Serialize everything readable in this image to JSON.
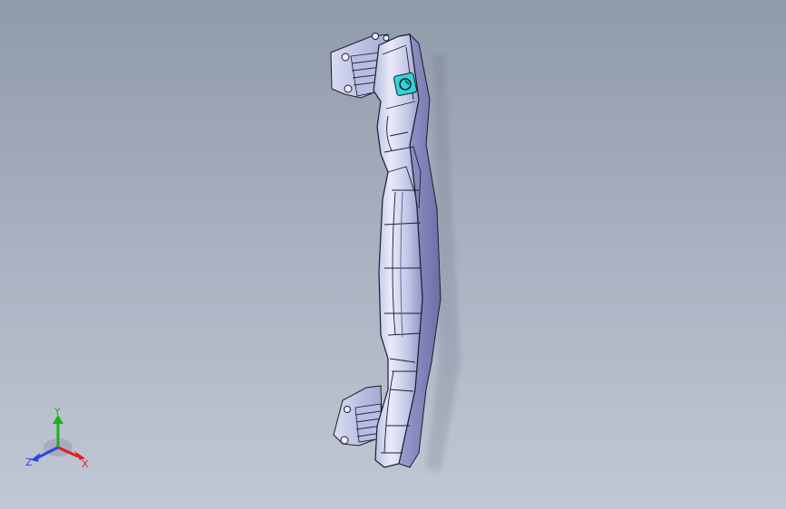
{
  "viewport": {
    "background_top": "#8f9aaa",
    "background_bottom": "#c1c8d4"
  },
  "model": {
    "part": "handle",
    "body_color": "#cfd3ec",
    "edge_color": "#1c1e2e",
    "selected_feature_color": "#2fd6d8"
  },
  "triad": {
    "x_label": "X",
    "y_label": "Y",
    "z_label": "Z",
    "x_color": "#e02020",
    "y_color": "#19b419",
    "z_color": "#2e46e6"
  }
}
